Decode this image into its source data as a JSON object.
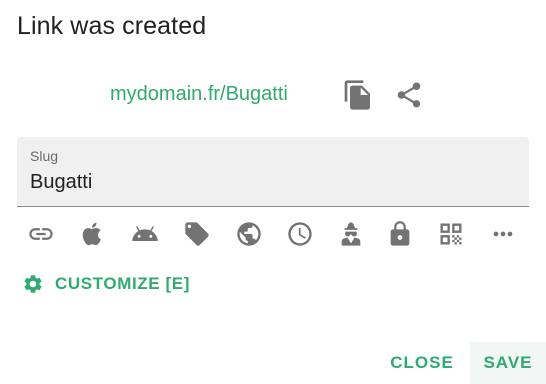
{
  "dialog": {
    "title": "Link was created",
    "link_text": "mydomain.fr/Bugatti",
    "slug": {
      "label": "Slug",
      "value": "Bugatti"
    },
    "option_icons": [
      "link-icon",
      "apple-icon",
      "android-icon",
      "tag-icon",
      "globe-icon",
      "clock-icon",
      "incognito-icon",
      "lock-icon",
      "qr-code-icon",
      "more-icon"
    ],
    "customize_label": "CUSTOMIZE [E]",
    "close_label": "CLOSE",
    "save_label": "SAVE"
  },
  "colors": {
    "accent": "#2eaa72",
    "icon": "#737373",
    "field_bg": "#f0f0f0",
    "title": "#212121"
  }
}
